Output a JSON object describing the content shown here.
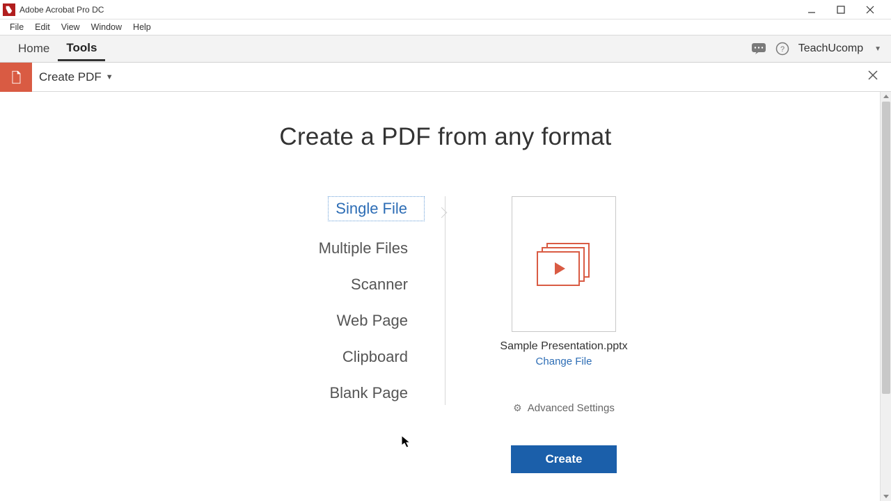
{
  "window": {
    "title": "Adobe Acrobat Pro DC"
  },
  "menu": {
    "items": [
      "File",
      "Edit",
      "View",
      "Window",
      "Help"
    ]
  },
  "nav": {
    "home": "Home",
    "tools": "Tools",
    "user": "TeachUcomp"
  },
  "tool_header": {
    "title": "Create PDF"
  },
  "main": {
    "heading": "Create a PDF from any format"
  },
  "sources": {
    "items": [
      "Single File",
      "Multiple Files",
      "Scanner",
      "Web Page",
      "Clipboard",
      "Blank Page"
    ],
    "selected_index": 0
  },
  "preview": {
    "file_name": "Sample Presentation.pptx",
    "change_file": "Change File",
    "advanced_settings": "Advanced Settings",
    "create_button": "Create"
  }
}
